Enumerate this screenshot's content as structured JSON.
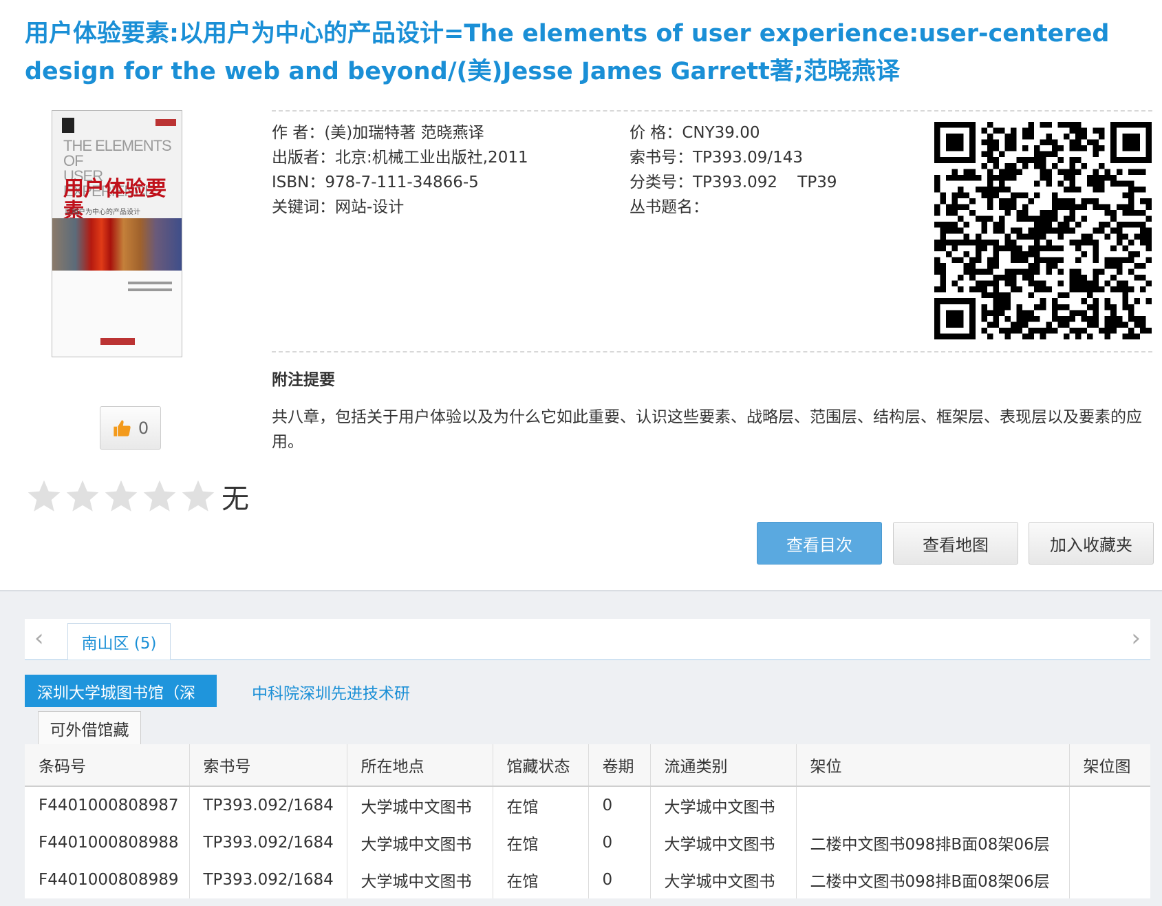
{
  "book": {
    "title": "用户体验要素:以用户为中心的产品设计=The elements of user experience:user-centered design for the web and beyond/(美)Jesse James Garrett著;范晓燕译",
    "cover": {
      "en_title_line1": "THE ELEMENTS OF",
      "en_title_line2": "USER EXPERIENCE",
      "cn_title": "用户体验要素",
      "cn_subtitle": "以用户为中心的产品设计"
    }
  },
  "meta_left": [
    {
      "label": "作 者：",
      "value": "(美)加瑞特著  范晓燕译"
    },
    {
      "label": "出版者：",
      "value": "北京:机械工业出版社,2011"
    },
    {
      "label": "ISBN：",
      "value": "978-7-111-34866-5"
    },
    {
      "label": "关键词：",
      "value": "网站-设计"
    }
  ],
  "meta_right": [
    {
      "label": "价 格：",
      "value": "CNY39.00"
    },
    {
      "label": "索书号：",
      "value": "TP393.09/143"
    },
    {
      "label": "分类号：",
      "value": "TP393.092    TP39"
    },
    {
      "label": "丛书题名：",
      "value": ""
    }
  ],
  "summary": {
    "heading": "附注提要",
    "text": "共八章，包括关于用户体验以及为什么它如此重要、认识这些要素、战略层、范围层、结构层、框架层、表现层以及要素的应用。"
  },
  "like": {
    "count": "0",
    "icon": "thumbs-up-icon"
  },
  "rating": {
    "stars": 5,
    "filled": 0,
    "label": "无",
    "color": "#e0e0e0"
  },
  "buttons": {
    "toc": "查看目次",
    "map": "查看地图",
    "favorite": "加入收藏夹"
  },
  "region_tab": "南山区 (5)",
  "libraries": {
    "active": "深圳大学城图书馆（深",
    "other": "中科院深圳先进技术研"
  },
  "holding_tab": "可外借馆藏",
  "table": {
    "headers": [
      "条码号",
      "索书号",
      "所在地点",
      "馆藏状态",
      "卷期",
      "流通类别",
      "架位",
      "架位图"
    ],
    "rows": [
      [
        "F4401000808987",
        "TP393.092/1684",
        "大学城中文图书",
        "在馆",
        "0",
        "大学城中文图书",
        "",
        ""
      ],
      [
        "F4401000808988",
        "TP393.092/1684",
        "大学城中文图书",
        "在馆",
        "0",
        "大学城中文图书",
        "二楼中文图书098排B面08架06层",
        ""
      ],
      [
        "F4401000808989",
        "TP393.092/1684",
        "大学城中文图书",
        "在馆",
        "0",
        "大学城中文图书",
        "二楼中文图书098排B面08架06层",
        ""
      ]
    ]
  },
  "colors": {
    "accent": "#1a8fd6",
    "primary_button": "#5aa9e0",
    "active_library": "#1f95dc"
  }
}
